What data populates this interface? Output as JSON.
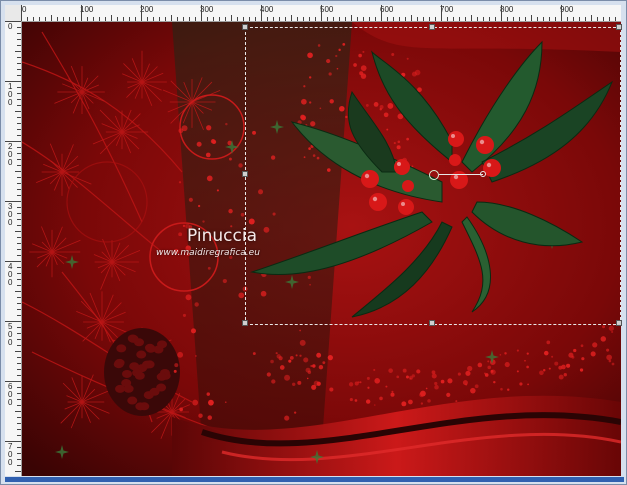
{
  "window": {
    "bottom_bar_color": "#3060b0"
  },
  "ruler": {
    "top_labels": [
      "0",
      "100",
      "200",
      "300",
      "400",
      "500",
      "600",
      "700",
      "800",
      "900"
    ],
    "left_labels": [
      "0",
      "100",
      "200",
      "300",
      "400",
      "500",
      "600",
      "700"
    ]
  },
  "canvas": {
    "background": "#7a0a0a",
    "accent": "#c81818",
    "holly_leaf": "#1f4a2a",
    "berry": "#d81818"
  },
  "watermark": {
    "title": "Pinuccia",
    "url": "www.maidiregrafica.eu"
  },
  "selection": {
    "style": "dashed",
    "color": "#e8e8e8"
  },
  "icons": [
    "rotation-pivot-icon",
    "selection-handle-icon"
  ]
}
